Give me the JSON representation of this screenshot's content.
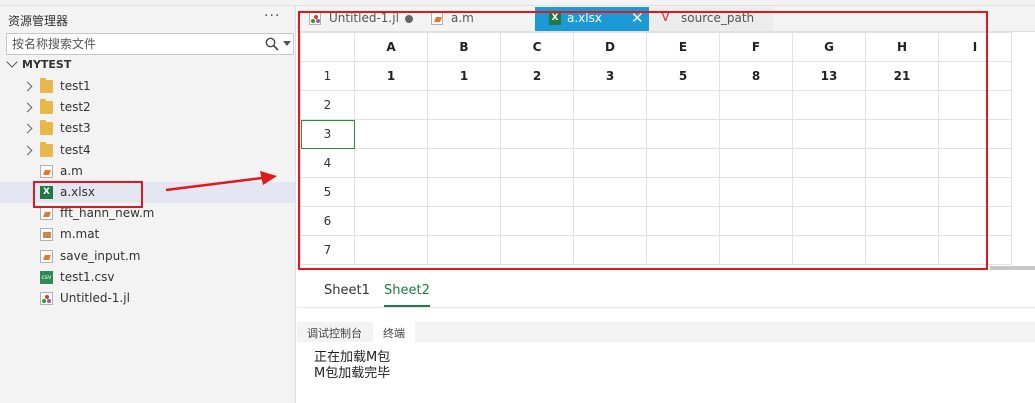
{
  "sidebar": {
    "title": "资源管理器",
    "more": "···",
    "search_placeholder": "按名称搜索文件",
    "root": "MYTEST",
    "items": [
      {
        "label": "test1",
        "type": "folder"
      },
      {
        "label": "test2",
        "type": "folder"
      },
      {
        "label": "test3",
        "type": "folder"
      },
      {
        "label": "test4",
        "type": "folder"
      },
      {
        "label": "a.m",
        "type": "m"
      },
      {
        "label": "a.xlsx",
        "type": "xlsx",
        "selected": true
      },
      {
        "label": "fft_hann_new.m",
        "type": "m"
      },
      {
        "label": "m.mat",
        "type": "mat"
      },
      {
        "label": "save_input.m",
        "type": "m"
      },
      {
        "label": "test1.csv",
        "type": "csv"
      },
      {
        "label": "Untitled-1.jl",
        "type": "jl"
      }
    ]
  },
  "tabs": [
    {
      "label": "Untitled-1.jl",
      "icon": "julia-file-icon",
      "modified": true
    },
    {
      "label": "a.m",
      "icon": "matlab-file-icon"
    },
    {
      "label": "a.xlsx",
      "icon": "excel-file-icon",
      "active": true,
      "close": "✕"
    },
    {
      "label": "source_path",
      "icon": "variable-icon",
      "glyph": "V"
    }
  ],
  "sheet": {
    "columns": [
      "A",
      "B",
      "C",
      "D",
      "E",
      "F",
      "G",
      "H",
      "I"
    ],
    "rows": [
      {
        "n": "1",
        "cells": [
          "1",
          "1",
          "2",
          "3",
          "5",
          "8",
          "13",
          "21",
          ""
        ]
      },
      {
        "n": "2",
        "cells": [
          "",
          "",
          "",
          "",
          "",
          "",
          "",
          "",
          ""
        ]
      },
      {
        "n": "3",
        "cells": [
          "",
          "",
          "",
          "",
          "",
          "",
          "",
          "",
          ""
        ]
      },
      {
        "n": "4",
        "cells": [
          "",
          "",
          "",
          "",
          "",
          "",
          "",
          "",
          ""
        ]
      },
      {
        "n": "5",
        "cells": [
          "",
          "",
          "",
          "",
          "",
          "",
          "",
          "",
          ""
        ]
      },
      {
        "n": "6",
        "cells": [
          "",
          "",
          "",
          "",
          "",
          "",
          "",
          "",
          ""
        ]
      },
      {
        "n": "7",
        "cells": [
          "",
          "",
          "",
          "",
          "",
          "",
          "",
          "",
          ""
        ]
      }
    ],
    "selected_row": "3"
  },
  "sheet_tabs": [
    {
      "label": "Sheet1"
    },
    {
      "label": "Sheet2",
      "active": true
    }
  ],
  "panel": {
    "tabs": [
      {
        "label": "调试控制台"
      },
      {
        "label": "终端",
        "active": true
      }
    ],
    "lines": [
      "正在加载M包",
      "M包加载完毕"
    ]
  },
  "colors": {
    "accent_tab": "#1c9ad6",
    "sheet_active": "#1e7a4a",
    "annotation": "#e0191e"
  }
}
